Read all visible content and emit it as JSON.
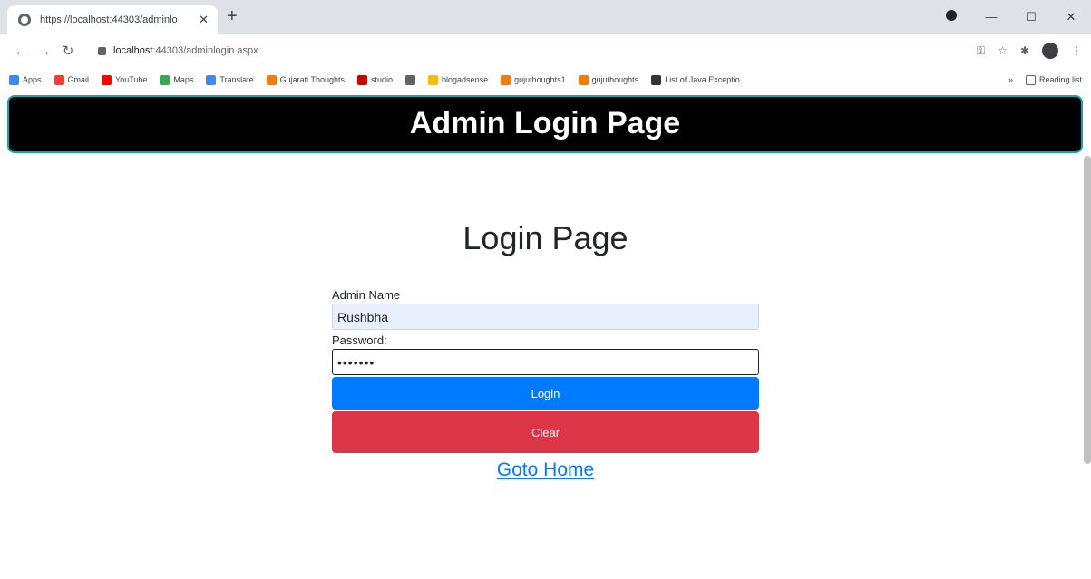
{
  "browser": {
    "tab_title": "https://localhost:44303/adminlo",
    "tab_close": "✕",
    "new_tab": "+",
    "window_controls": [
      "—",
      "☐",
      "✕"
    ],
    "url_host": "localhost",
    "url_rest": ":44303/adminlogin.aspx",
    "bookmarks": [
      {
        "label": "Apps",
        "color": "#4285f4"
      },
      {
        "label": "Gmail",
        "color": "#ea4335"
      },
      {
        "label": "YouTube",
        "color": "#ff0000"
      },
      {
        "label": "Maps",
        "color": "#34a853"
      },
      {
        "label": "Translate",
        "color": "#4285f4"
      },
      {
        "label": "Gujarati Thoughts",
        "color": "#f57c00"
      },
      {
        "label": "studio",
        "color": "#cc0000"
      },
      {
        "label": "",
        "color": "#5f6368"
      },
      {
        "label": "blogadsense",
        "color": "#fbbc04"
      },
      {
        "label": "gujuthoughts1",
        "color": "#f57c00"
      },
      {
        "label": "gujuthoughts",
        "color": "#f57c00"
      },
      {
        "label": "List of Java Exceptio...",
        "color": "#333333"
      }
    ],
    "bookmarks_more": "»",
    "reading_list": "Reading list"
  },
  "page": {
    "banner_title": "Admin Login Page",
    "heading": "Login Page",
    "admin_name_label": "Admin Name",
    "admin_name_value": "Rushbha",
    "password_label": "Password:",
    "password_value": "•••••••",
    "login_button": "Login",
    "clear_button": "Clear",
    "home_link": "Goto Home"
  },
  "colors": {
    "banner_bg": "#000000",
    "banner_border": "#17a2b8",
    "primary": "#007bff",
    "danger": "#dc3545"
  }
}
